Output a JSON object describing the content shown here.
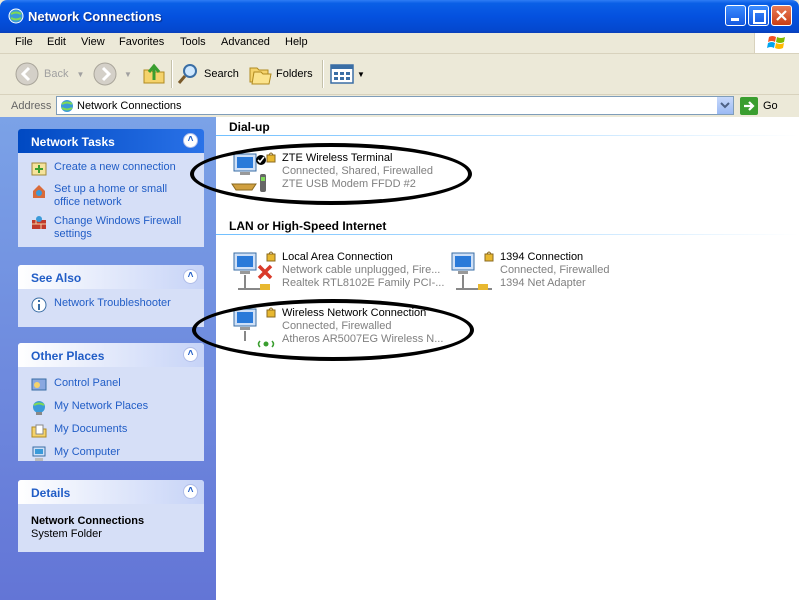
{
  "window": {
    "title": "Network Connections"
  },
  "menu": [
    "File",
    "Edit",
    "View",
    "Favorites",
    "Tools",
    "Advanced",
    "Help"
  ],
  "toolbar": {
    "back": "Back",
    "search": "Search",
    "folders": "Folders"
  },
  "address": {
    "label": "Address",
    "value": "Network Connections",
    "go": "Go"
  },
  "panels": {
    "network_tasks": {
      "title": "Network Tasks",
      "items": [
        "Create a new connection",
        "Set up a home or small office network",
        "Change Windows Firewall settings"
      ]
    },
    "see_also": {
      "title": "See Also",
      "items": [
        "Network Troubleshooter"
      ]
    },
    "other_places": {
      "title": "Other Places",
      "items": [
        "Control Panel",
        "My Network Places",
        "My Documents",
        "My Computer"
      ]
    },
    "details": {
      "title": "Details",
      "name": "Network Connections",
      "type": "System Folder"
    }
  },
  "groups": {
    "dialup": {
      "title": "Dial-up"
    },
    "lan": {
      "title": "LAN or High-Speed Internet"
    }
  },
  "connections": {
    "zte": {
      "name": "ZTE Wireless Terminal",
      "status": "Connected, Shared, Firewalled",
      "device": "ZTE USB Modem FFDD #2"
    },
    "lan": {
      "name": "Local Area Connection",
      "status": "Network cable unplugged, Fire...",
      "device": "Realtek RTL8102E Family PCI-..."
    },
    "ieee": {
      "name": "1394 Connection",
      "status": "Connected, Firewalled",
      "device": "1394 Net Adapter"
    },
    "wifi": {
      "name": "Wireless Network Connection",
      "status": "Connected, Firewalled",
      "device": "Atheros AR5007EG Wireless N..."
    }
  }
}
